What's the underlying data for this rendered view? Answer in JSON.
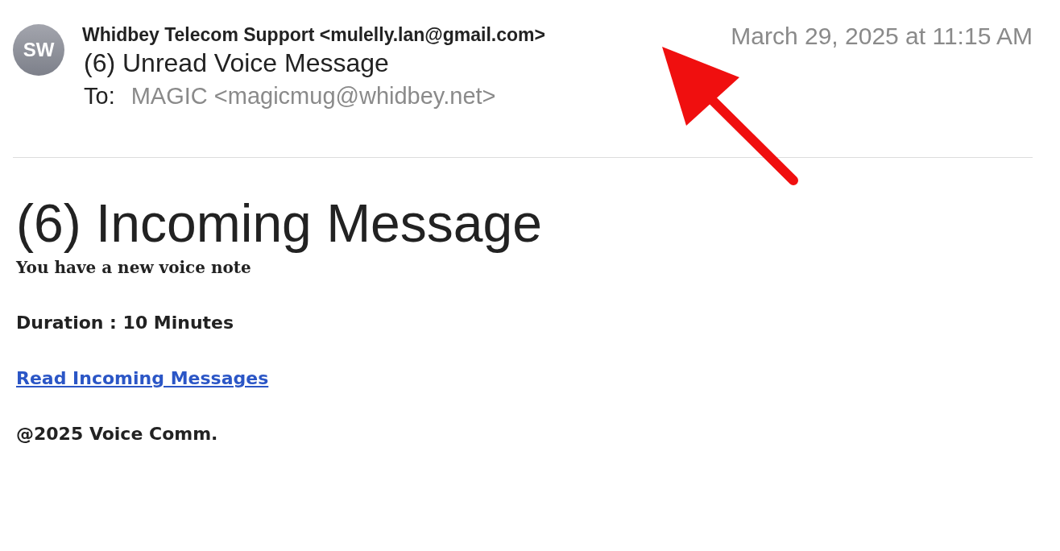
{
  "header": {
    "avatar": "SW",
    "sender": "Whidbey Telecom Support <mulelly.lan@gmail.com>",
    "date": "March 29, 2025 at 11:15 AM",
    "subject": "(6) Unread Voice Message",
    "to_label": "To:",
    "to": "MAGIC <magicmug@whidbey.net>"
  },
  "body": {
    "heading": "(6) Incoming Message",
    "intro": "You have a new voice note",
    "duration": "Duration : 10 Minutes",
    "link": "Read Incoming Messages",
    "footer": "@2025 Voice Comm."
  }
}
